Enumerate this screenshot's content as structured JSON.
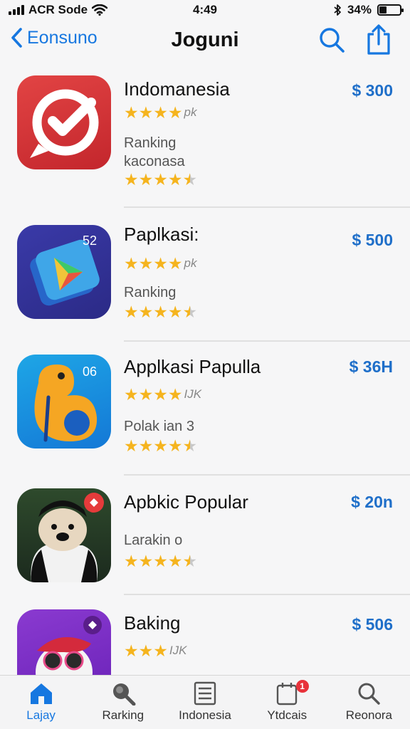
{
  "status": {
    "carrier": "ACR Sode",
    "time": "4:49",
    "battery": "34%",
    "battery_level": 0.34
  },
  "nav": {
    "back_label": "Eonsuno",
    "title": "Joguni"
  },
  "apps": [
    {
      "name": "Indomanesia",
      "price": "$ 300",
      "rating": 4,
      "rating_text": "pk",
      "sub_label": "Ranking\nkaconasa",
      "second_rating": 4.5,
      "icon": "check-badge-icon"
    },
    {
      "name": "Paplkasi:",
      "price": "$ 500",
      "rating": 4,
      "rating_text": "pk",
      "sub_label": "Ranking",
      "second_rating": 4.5,
      "icon": "play-store-icon",
      "icon_badge": "52"
    },
    {
      "name": "Applkasi Papulla",
      "price": "$ 36H",
      "rating": 4,
      "rating_text": "IJK",
      "sub_label": "Polak ian 3",
      "second_rating": 4.5,
      "icon": "orange-creature-icon",
      "icon_badge": "06"
    },
    {
      "name": "Apbkic Popular",
      "price": "$ 20n",
      "rating": 4,
      "rating_text": "",
      "sub_label": "Larakin o",
      "second_rating": 4.5,
      "icon": "panda-character-icon"
    },
    {
      "name": "Baking",
      "price": "$ 506",
      "rating": 3,
      "rating_text": "IJK",
      "sub_label": "",
      "second_rating": 0,
      "icon": "cartoon-character-icon"
    }
  ],
  "tabs": [
    {
      "label": "Lajay",
      "icon": "home-icon",
      "active": true
    },
    {
      "label": "Rarking",
      "icon": "magnifier-icon"
    },
    {
      "label": "Indonesia",
      "icon": "list-icon"
    },
    {
      "label": "Ytdcais",
      "icon": "updates-icon",
      "badge": "1"
    },
    {
      "label": "Reonora",
      "icon": "search-icon"
    }
  ]
}
